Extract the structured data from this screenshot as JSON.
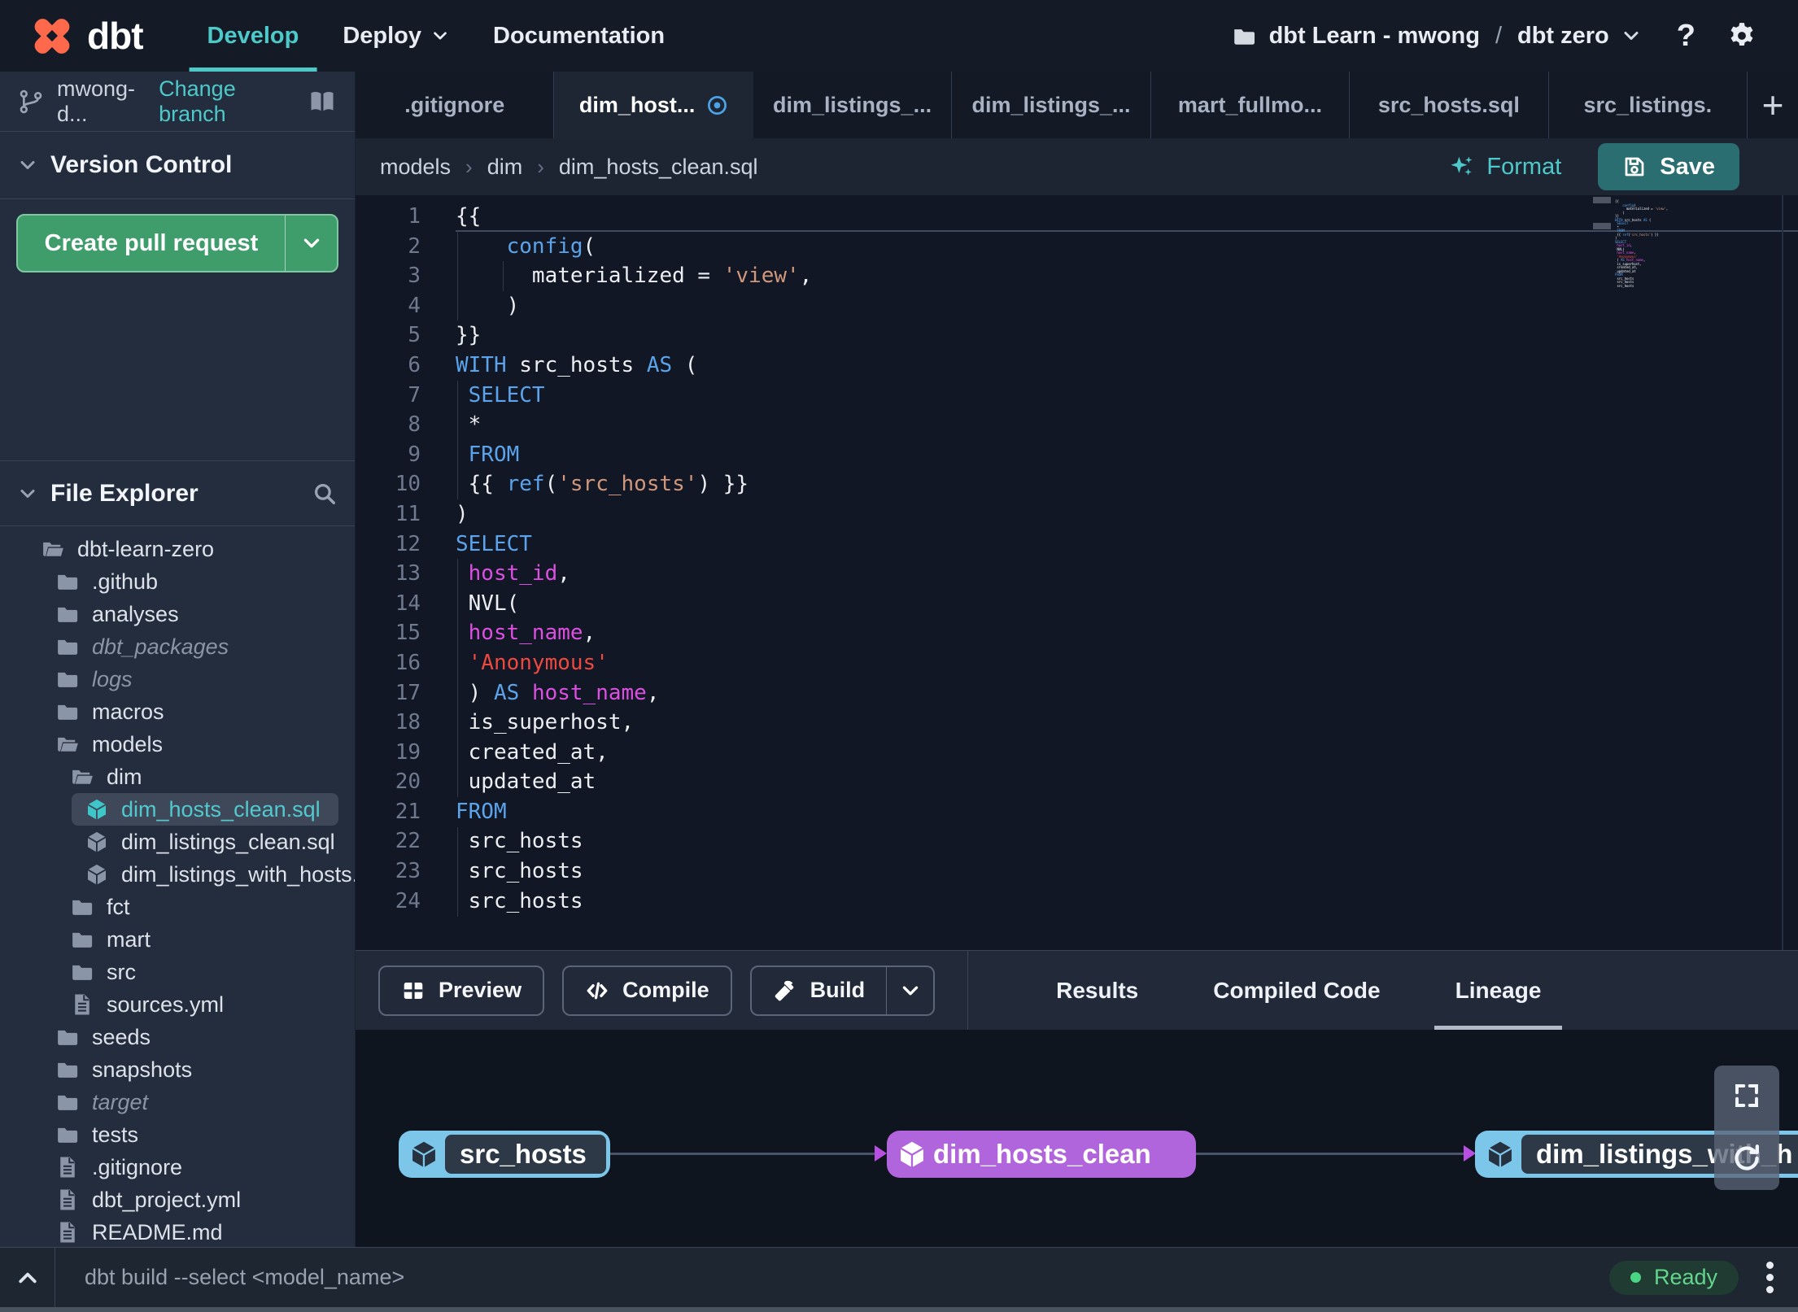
{
  "topnav": {
    "brand": "dbt",
    "items": [
      {
        "label": "Develop",
        "active": true,
        "caret": false
      },
      {
        "label": "Deploy",
        "active": false,
        "caret": true
      },
      {
        "label": "Documentation",
        "active": false,
        "caret": false
      }
    ],
    "project": {
      "account": "dbt Learn - mwong",
      "separator": "/",
      "name": "dbt zero"
    },
    "help_label": "?"
  },
  "sidebar": {
    "branch": {
      "name": "mwong-d...",
      "change_link": "Change branch"
    },
    "version_control": {
      "title": "Version Control",
      "pr_button": "Create pull request"
    },
    "file_explorer": {
      "title": "File Explorer"
    },
    "tree": [
      {
        "label": "dbt-learn-zero",
        "icon": "folder-open",
        "level": 0
      },
      {
        "label": ".github",
        "icon": "folder",
        "level": 1
      },
      {
        "label": "analyses",
        "icon": "folder",
        "level": 1
      },
      {
        "label": "dbt_packages",
        "icon": "folder",
        "level": 1,
        "muted": true
      },
      {
        "label": "logs",
        "icon": "folder",
        "level": 1,
        "muted": true
      },
      {
        "label": "macros",
        "icon": "folder",
        "level": 1
      },
      {
        "label": "models",
        "icon": "folder-open",
        "level": 1
      },
      {
        "label": "dim",
        "icon": "folder-open",
        "level": 2
      },
      {
        "label": "dim_hosts_clean.sql",
        "icon": "model",
        "level": 3,
        "selected": true,
        "modified": true
      },
      {
        "label": "dim_listings_clean.sql",
        "icon": "model",
        "level": 3
      },
      {
        "label": "dim_listings_with_hosts...",
        "icon": "model",
        "level": 3
      },
      {
        "label": "fct",
        "icon": "folder",
        "level": 2
      },
      {
        "label": "mart",
        "icon": "folder",
        "level": 2
      },
      {
        "label": "src",
        "icon": "folder",
        "level": 2
      },
      {
        "label": "sources.yml",
        "icon": "file",
        "level": 2
      },
      {
        "label": "seeds",
        "icon": "folder",
        "level": 1
      },
      {
        "label": "snapshots",
        "icon": "folder",
        "level": 1
      },
      {
        "label": "target",
        "icon": "folder",
        "level": 1,
        "muted": true
      },
      {
        "label": "tests",
        "icon": "folder",
        "level": 1
      },
      {
        "label": ".gitignore",
        "icon": "file",
        "level": 1
      },
      {
        "label": "dbt_project.yml",
        "icon": "file",
        "level": 1
      },
      {
        "label": "README.md",
        "icon": "file",
        "level": 1
      }
    ]
  },
  "editor": {
    "tabs": [
      {
        "label": ".gitignore"
      },
      {
        "label": "dim_host...",
        "active": true,
        "modified": true
      },
      {
        "label": "dim_listings_..."
      },
      {
        "label": "dim_listings_..."
      },
      {
        "label": "mart_fullmo..."
      },
      {
        "label": "src_hosts.sql"
      },
      {
        "label": "src_listings."
      }
    ],
    "new_tab_label": "+",
    "breadcrumb": {
      "items": [
        "models",
        "dim",
        "dim_hosts_clean.sql"
      ],
      "separator": "›"
    },
    "actions": {
      "format": "Format",
      "save": "Save"
    },
    "code_lines": [
      {
        "n": 1,
        "cursor": true,
        "tokens": [
          [
            "t",
            "{{"
          ]
        ]
      },
      {
        "n": 2,
        "tokens": [
          [
            "t",
            "    "
          ],
          [
            "k",
            "config"
          ],
          [
            "t",
            "("
          ]
        ]
      },
      {
        "n": 3,
        "tokens": [
          [
            "t",
            "      materialized = "
          ],
          [
            "s",
            "'view'"
          ],
          [
            "t",
            ","
          ]
        ]
      },
      {
        "n": 4,
        "tokens": [
          [
            "t",
            "    )"
          ]
        ]
      },
      {
        "n": 5,
        "tokens": [
          [
            "t",
            "}}"
          ]
        ]
      },
      {
        "n": 6,
        "tokens": [
          [
            "k",
            "WITH"
          ],
          [
            "t",
            " src_hosts "
          ],
          [
            "k",
            "AS"
          ],
          [
            "t",
            " ("
          ]
        ]
      },
      {
        "n": 7,
        "tokens": [
          [
            "t",
            " "
          ],
          [
            "k",
            "SELECT"
          ]
        ]
      },
      {
        "n": 8,
        "tokens": [
          [
            "t",
            " *"
          ]
        ]
      },
      {
        "n": 9,
        "tokens": [
          [
            "t",
            " "
          ],
          [
            "k",
            "FROM"
          ]
        ]
      },
      {
        "n": 10,
        "tokens": [
          [
            "t",
            " {{ "
          ],
          [
            "k",
            "ref"
          ],
          [
            "t",
            "("
          ],
          [
            "s",
            "'src_hosts'"
          ],
          [
            "t",
            ") }}"
          ]
        ]
      },
      {
        "n": 11,
        "tokens": [
          [
            "t",
            ")"
          ]
        ]
      },
      {
        "n": 12,
        "tokens": [
          [
            "k",
            "SELECT"
          ]
        ]
      },
      {
        "n": 13,
        "tokens": [
          [
            "t",
            " "
          ],
          [
            "m",
            "host_id"
          ],
          [
            "t",
            ","
          ]
        ]
      },
      {
        "n": 14,
        "tokens": [
          [
            "t",
            " NVL("
          ]
        ]
      },
      {
        "n": 15,
        "tokens": [
          [
            "t",
            " "
          ],
          [
            "m",
            "host_name"
          ],
          [
            "t",
            ","
          ]
        ]
      },
      {
        "n": 16,
        "tokens": [
          [
            "t",
            " "
          ],
          [
            "r",
            "'Anonymous'"
          ]
        ]
      },
      {
        "n": 17,
        "tokens": [
          [
            "t",
            " ) "
          ],
          [
            "k",
            "AS"
          ],
          [
            "t",
            " "
          ],
          [
            "m",
            "host_name"
          ],
          [
            "t",
            ","
          ]
        ]
      },
      {
        "n": 18,
        "tokens": [
          [
            "t",
            " is_superhost,"
          ]
        ]
      },
      {
        "n": 19,
        "tokens": [
          [
            "t",
            " created_at,"
          ]
        ]
      },
      {
        "n": 20,
        "tokens": [
          [
            "t",
            " updated_at"
          ]
        ]
      },
      {
        "n": 21,
        "tokens": [
          [
            "k",
            "FROM"
          ]
        ]
      },
      {
        "n": 22,
        "tokens": [
          [
            "t",
            " src_hosts"
          ]
        ]
      },
      {
        "n": 23,
        "tokens": [
          [
            "t",
            " src_hosts"
          ]
        ]
      },
      {
        "n": 24,
        "tokens": [
          [
            "t",
            " src_hosts"
          ]
        ]
      }
    ]
  },
  "bottom_panel": {
    "buttons": [
      {
        "label": "Preview",
        "icon": "table"
      },
      {
        "label": "Compile",
        "icon": "code"
      },
      {
        "label": "Build",
        "icon": "hammer",
        "split": true
      }
    ],
    "tabs": [
      {
        "label": "Results"
      },
      {
        "label": "Compiled Code"
      },
      {
        "label": "Lineage",
        "active": true
      }
    ]
  },
  "lineage": {
    "nodes": [
      {
        "label": "src_hosts",
        "style": "outlined"
      },
      {
        "label": "dim_hosts_clean",
        "style": "solid"
      },
      {
        "label": "dim_listings_with_h",
        "style": "outlined"
      }
    ]
  },
  "statusbar": {
    "command_placeholder": "dbt build --select <model_name>",
    "status": "Ready"
  },
  "colors": {
    "accent_teal": "#4ec9c9",
    "brand_orange": "#ff694b",
    "node_blue": "#7cc6e9",
    "node_purple": "#b165dc",
    "button_green": "#3f9c6b",
    "status_green": "#5fd38d"
  }
}
